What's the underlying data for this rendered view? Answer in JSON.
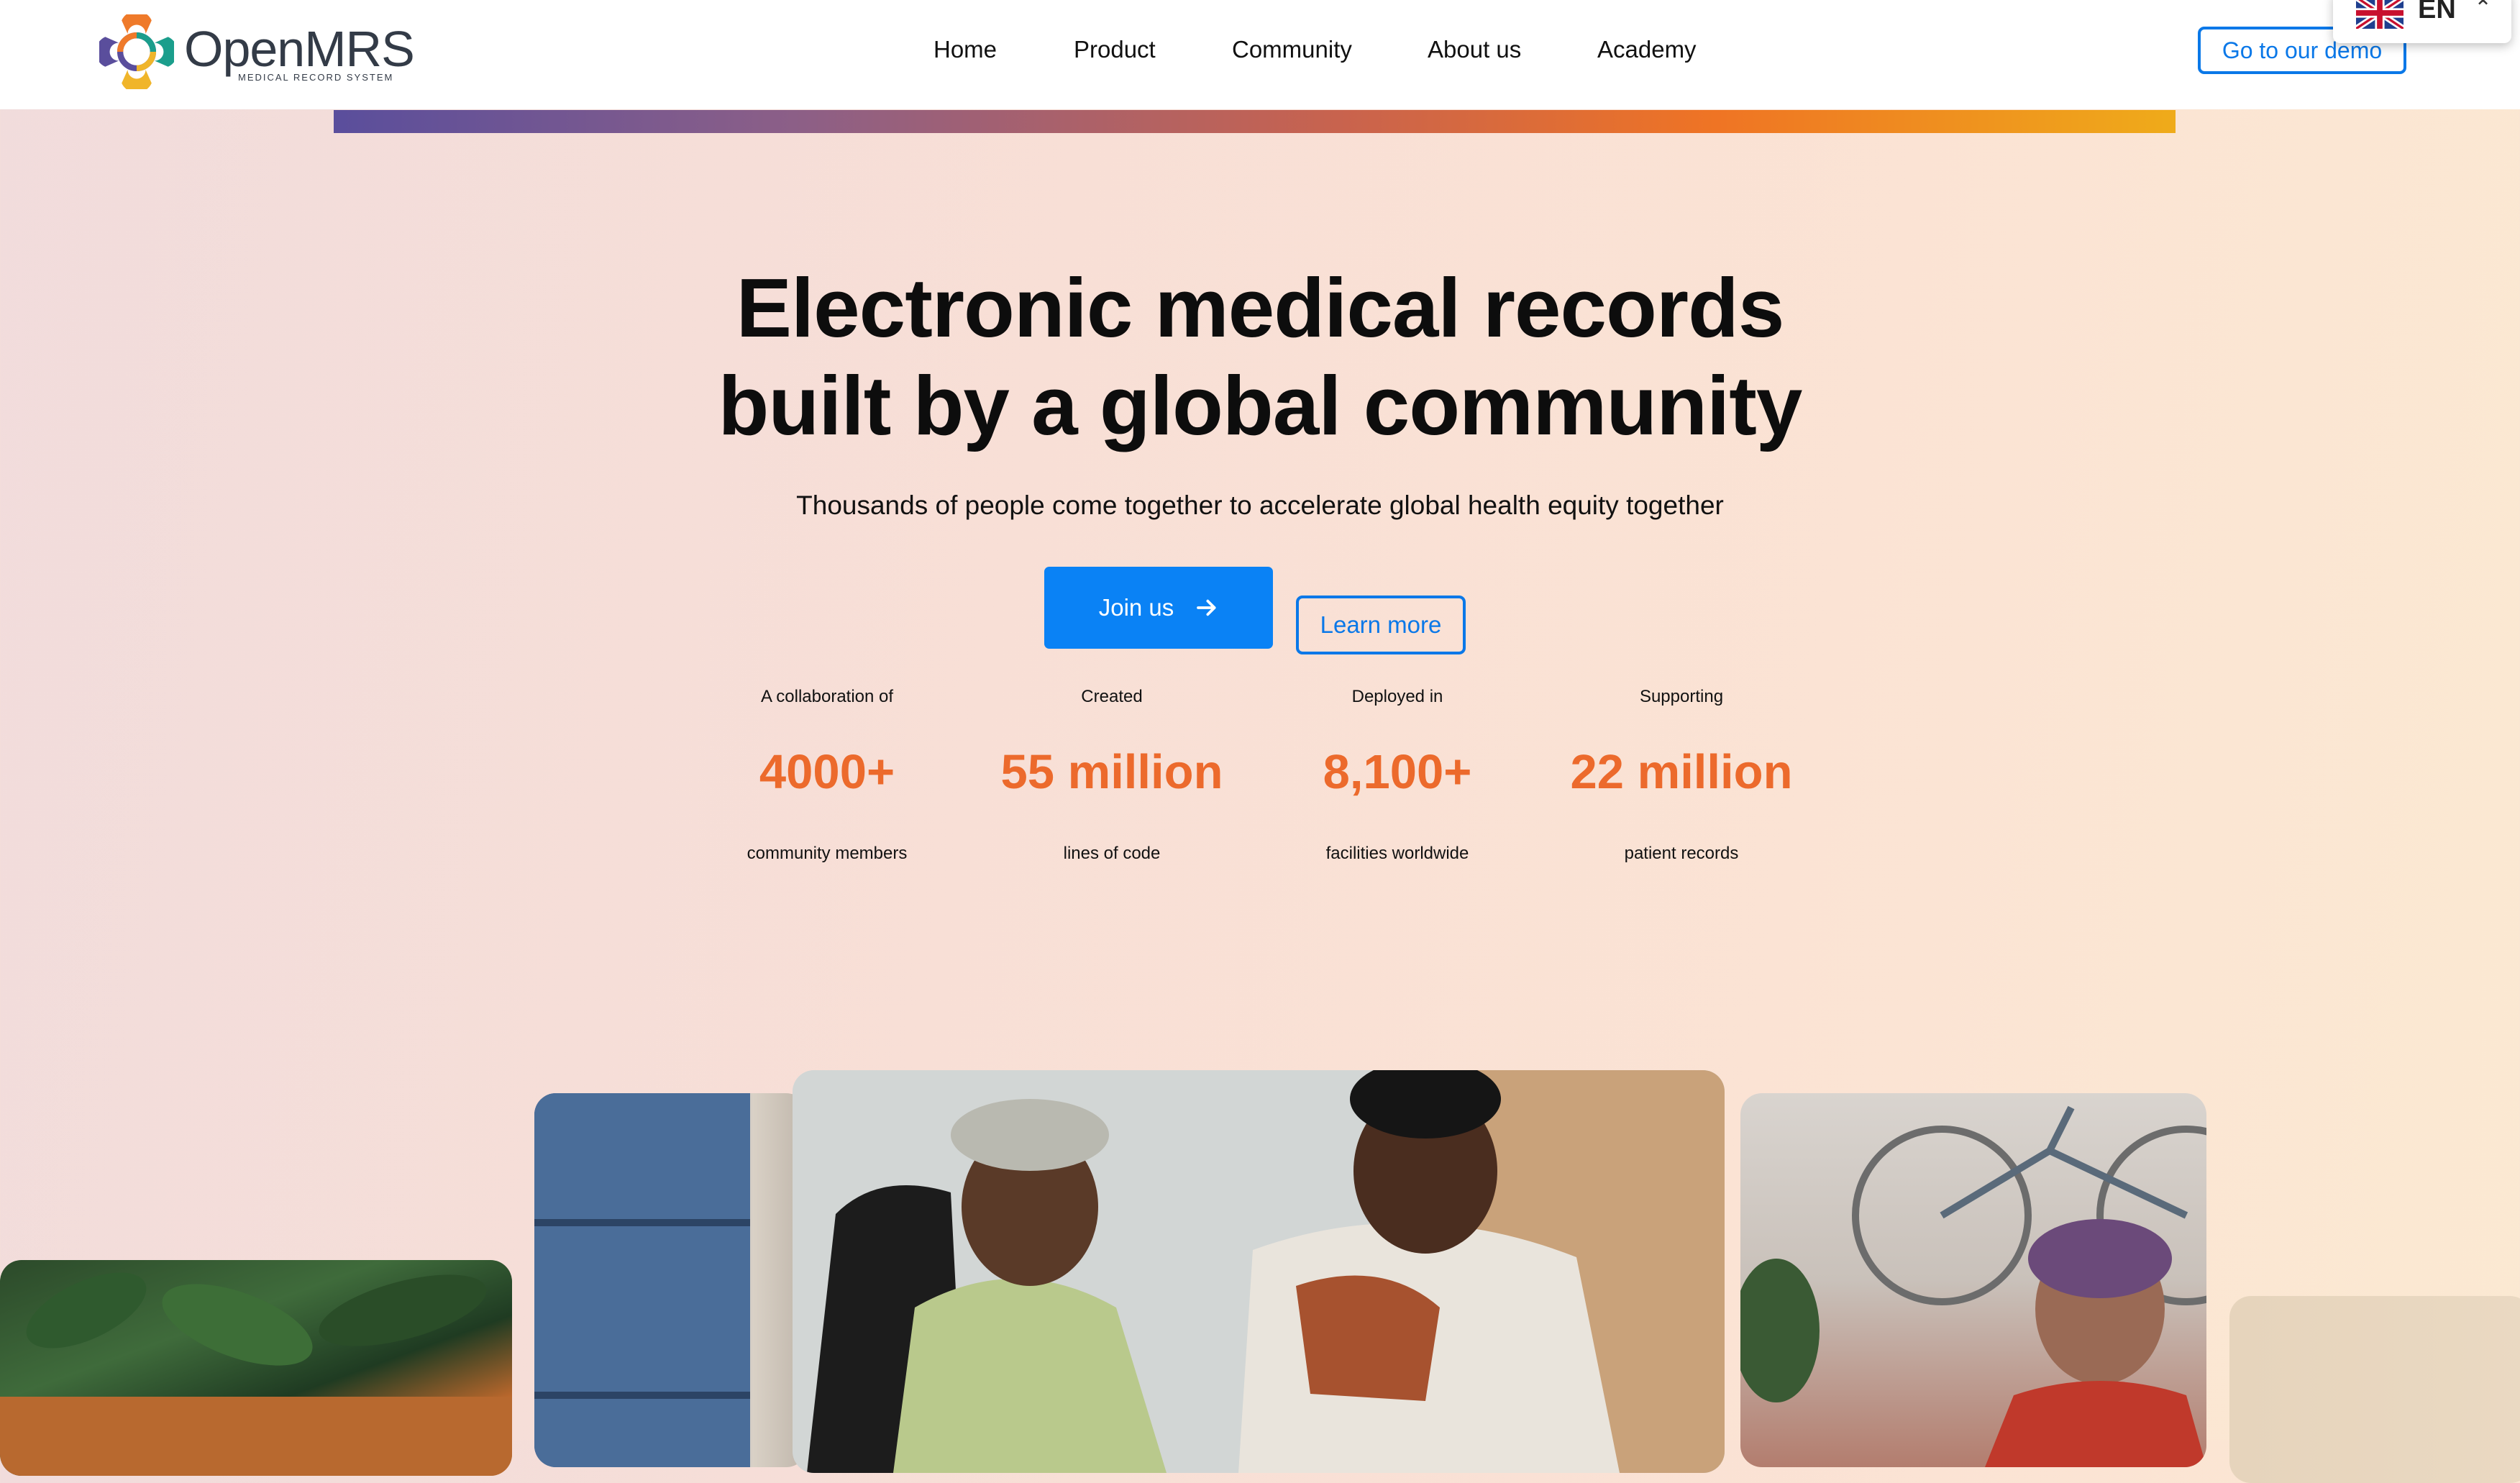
{
  "header": {
    "logo": {
      "name": "OpenMRS",
      "tagline": "MEDICAL RECORD SYSTEM"
    },
    "nav": [
      "Home",
      "Product",
      "Community",
      "About us",
      "Academy"
    ],
    "demo_button": "Go to our demo",
    "language": {
      "code": "EN",
      "flag": "uk-flag-icon"
    }
  },
  "hero": {
    "title_line1": "Electronic medical records",
    "title_line2": "built by a global community",
    "subtitle": "Thousands of people come together to accelerate global health equity together",
    "join_button": "Join us",
    "learn_button": "Learn more"
  },
  "stats": [
    {
      "top": "A collaboration of",
      "value": "4000+",
      "bottom": "community members"
    },
    {
      "top": "Created",
      "value": "55 million",
      "bottom": "lines of code"
    },
    {
      "top": "Deployed in",
      "value": "8,100+",
      "bottom": "facilities worldwide"
    },
    {
      "top": "Supporting",
      "value": "22 million",
      "bottom": "patient records"
    }
  ],
  "colors": {
    "accent_blue": "#0a82f5",
    "stat_orange": "#ec6a2c",
    "gradient_bar": [
      "#5a4e9c",
      "#c9634d",
      "#ef7424",
      "#efab1a"
    ]
  }
}
